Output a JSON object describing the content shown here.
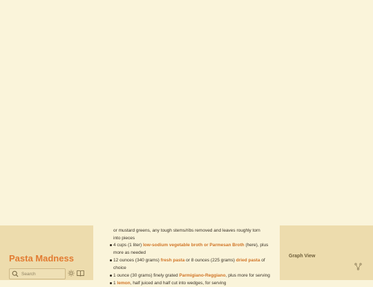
{
  "sidebar": {
    "site_title": "Pasta Madness",
    "search": {
      "placeholder": "Search"
    },
    "icons": [
      "search-icon",
      "sun-icon",
      "book-icon"
    ]
  },
  "content": {
    "continuation": "or mustard greens, any tough stems/ribs removed and leaves roughly torn into pieces",
    "items": [
      {
        "a": "4 cups (1 liter) ",
        "link1": "low-sodium vegetable broth or Parmesan Broth",
        "b": " (here), plus more as needed"
      },
      {
        "a": "12 ounces (340 grams) ",
        "link1": "fresh pasta",
        "b": " or 8 ounces (225 grams) ",
        "link2": "dried pasta",
        "c": " of choice"
      },
      {
        "a": "1 ounce (30 grams) finely grated ",
        "link1": "Parmigiano-Reggiano",
        "b": ", plus more for serving"
      },
      {
        "a": "1 ",
        "link1": "lemon",
        "b": ", half juiced and half cut into wedges, for serving"
      }
    ]
  },
  "graph": {
    "title": "Graph View",
    "icon": "graph-icon"
  },
  "colors": {
    "background": "#faf4da",
    "sidebar": "#eddcad",
    "accent": "#e27b31",
    "link": "#d07324"
  }
}
